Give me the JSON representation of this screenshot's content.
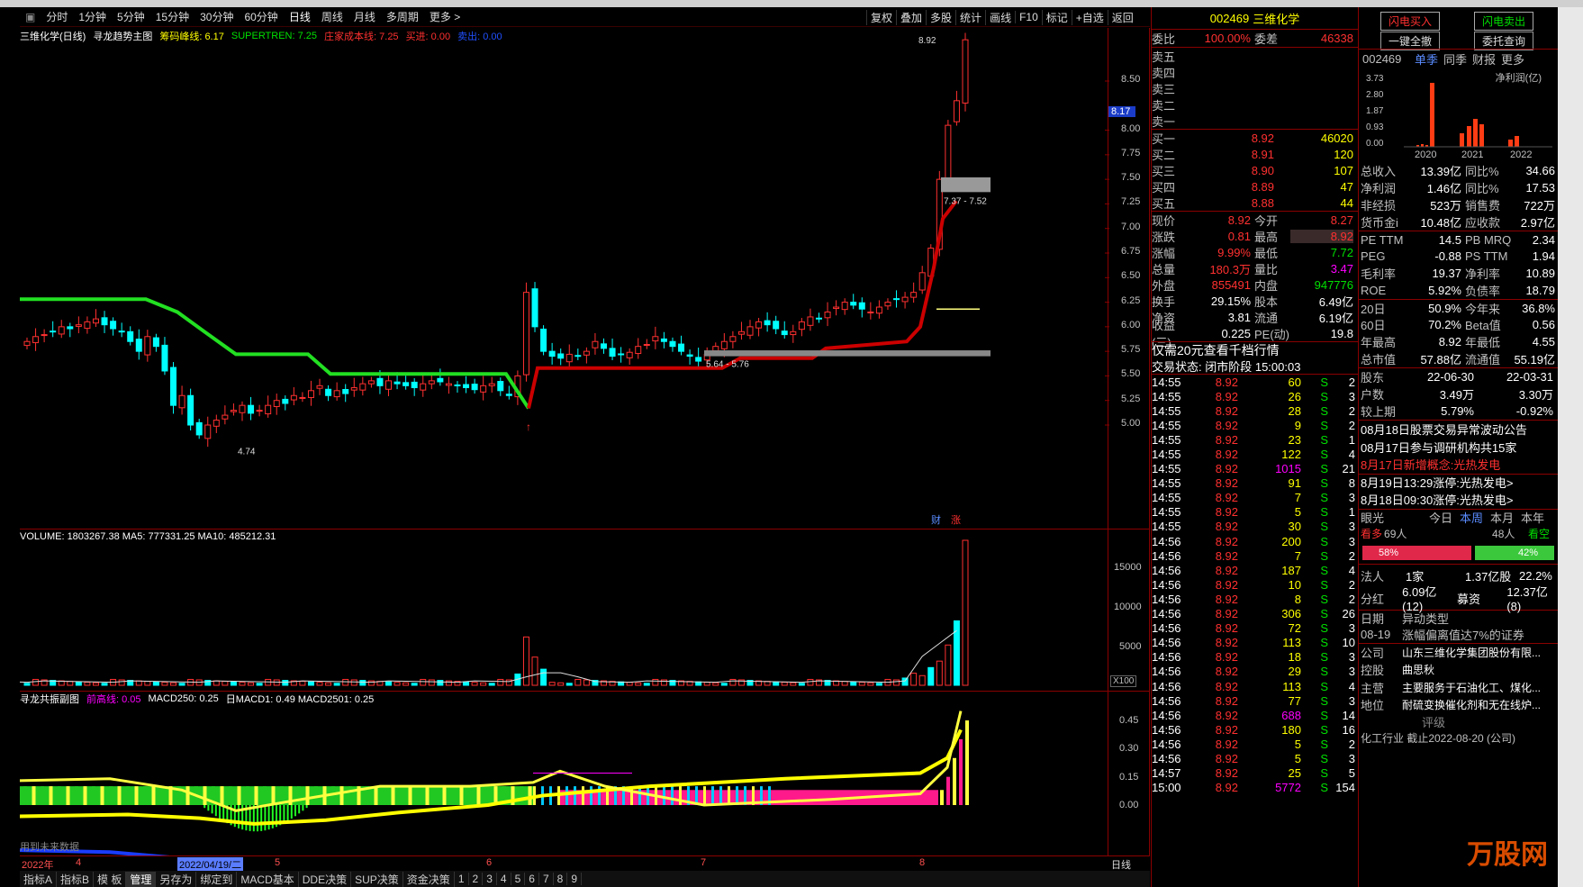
{
  "toolbar": {
    "items": [
      "分时",
      "1分钟",
      "5分钟",
      "15分钟",
      "30分钟",
      "60分钟",
      "日线",
      "周线",
      "月线",
      "多周期",
      "更多 >"
    ],
    "right": [
      "复权",
      "叠加",
      "多股",
      "统计",
      "画线",
      "F10",
      "标记",
      "+自选",
      "返回"
    ]
  },
  "main": {
    "legend": {
      "title": "三维化学(日线)",
      "indicator": "寻龙趋势主图",
      "chip": "筹码峰线: 6.17",
      "supertrend": "SUPERTREN: 7.25",
      "cost": "庄家成本线: 7.25",
      "buy": "买进: 0.00",
      "sell": "卖出: 0.00"
    },
    "y_labels": [
      "8.50",
      "8.00",
      "7.75",
      "7.50",
      "7.25",
      "7.00",
      "6.75",
      "6.50",
      "6.25",
      "6.00",
      "5.75",
      "5.50",
      "5.25",
      "5.00"
    ],
    "price_tag": "8.17",
    "high_label": "8.92",
    "low_label": "4.74",
    "box_label_high": "7.37 - 7.52",
    "box_label_low": "5.64 - 5.76",
    "cai": "财",
    "zhang": "涨"
  },
  "volume": {
    "legend": "VOLUME: 1803267.38  MA5: 777331.25  MA10: 485212.31",
    "y_labels": [
      "15000",
      "10000",
      "5000"
    ],
    "unit": "X100"
  },
  "macd": {
    "legend_a": "寻龙共振副图",
    "legend_b": "前高线: 0.05",
    "legend_c": "MACD250: 0.25",
    "legend_d": "日MACD1: 0.49  MACD2501: 0.25",
    "y_labels": [
      "0.45",
      "0.30",
      "0.15",
      "0.00"
    ],
    "note": "用到未来数据"
  },
  "timeaxis": {
    "year": "2022年",
    "m4": "4",
    "date": "2022/04/19/二",
    "m5": "5",
    "m6": "6",
    "m7": "7",
    "m8": "8",
    "period": "日线"
  },
  "tabs": [
    "指标A",
    "指标B",
    "模 板",
    "管理",
    "另存为",
    "绑定到",
    "MACD基本",
    "DDE决策",
    "SUP决策",
    "资金决策",
    "1",
    "2",
    "3",
    "4",
    "5",
    "6",
    "7",
    "8",
    "9"
  ],
  "quote": {
    "code": "002469",
    "name": "三维化学",
    "weibi_label": "委比",
    "weibi": "100.00%",
    "weicha_label": "委差",
    "weicha": "46338",
    "sells": [
      "卖五",
      "卖四",
      "卖三",
      "卖二",
      "卖一"
    ],
    "buys": [
      {
        "l": "买一",
        "p": "8.92",
        "v": "46020"
      },
      {
        "l": "买二",
        "p": "8.91",
        "v": "120"
      },
      {
        "l": "买三",
        "p": "8.90",
        "v": "107"
      },
      {
        "l": "买四",
        "p": "8.89",
        "v": "47"
      },
      {
        "l": "买五",
        "p": "8.88",
        "v": "44"
      }
    ],
    "stats": [
      [
        "现价",
        "8.92",
        "今开",
        "8.27"
      ],
      [
        "涨跌",
        "0.81",
        "最高",
        "8.92"
      ],
      [
        "涨幅",
        "9.99%",
        "最低",
        "7.72"
      ],
      [
        "总量",
        "180.3万",
        "量比",
        "3.47"
      ],
      [
        "外盘",
        "855491",
        "内盘",
        "947776"
      ],
      [
        "换手",
        "29.15%",
        "股本",
        "6.49亿"
      ],
      [
        "净资",
        "3.81",
        "流通",
        "6.19亿"
      ],
      [
        "收益(三)",
        "0.225",
        "PE(动)",
        "19.8"
      ]
    ],
    "promo": "仅需20元查看千档行情",
    "state": "交易状态: 闭市阶段 15:00:03",
    "ticks": [
      [
        "14:55",
        "8.92",
        "60",
        "S",
        "2"
      ],
      [
        "14:55",
        "8.92",
        "26",
        "S",
        "3"
      ],
      [
        "14:55",
        "8.92",
        "28",
        "S",
        "2"
      ],
      [
        "14:55",
        "8.92",
        "9",
        "S",
        "2"
      ],
      [
        "14:55",
        "8.92",
        "23",
        "S",
        "1"
      ],
      [
        "14:55",
        "8.92",
        "122",
        "S",
        "4"
      ],
      [
        "14:55",
        "8.92",
        "1015",
        "S",
        "21"
      ],
      [
        "14:55",
        "8.92",
        "91",
        "S",
        "8"
      ],
      [
        "14:55",
        "8.92",
        "7",
        "S",
        "3"
      ],
      [
        "14:55",
        "8.92",
        "5",
        "S",
        "1"
      ],
      [
        "14:55",
        "8.92",
        "30",
        "S",
        "3"
      ],
      [
        "14:56",
        "8.92",
        "200",
        "S",
        "3"
      ],
      [
        "14:56",
        "8.92",
        "7",
        "S",
        "2"
      ],
      [
        "14:56",
        "8.92",
        "187",
        "S",
        "4"
      ],
      [
        "14:56",
        "8.92",
        "10",
        "S",
        "2"
      ],
      [
        "14:56",
        "8.92",
        "8",
        "S",
        "2"
      ],
      [
        "14:56",
        "8.92",
        "306",
        "S",
        "26"
      ],
      [
        "14:56",
        "8.92",
        "72",
        "S",
        "3"
      ],
      [
        "14:56",
        "8.92",
        "113",
        "S",
        "10"
      ],
      [
        "14:56",
        "8.92",
        "18",
        "S",
        "3"
      ],
      [
        "14:56",
        "8.92",
        "29",
        "S",
        "3"
      ],
      [
        "14:56",
        "8.92",
        "113",
        "S",
        "4"
      ],
      [
        "14:56",
        "8.92",
        "77",
        "S",
        "3"
      ],
      [
        "14:56",
        "8.92",
        "688",
        "S",
        "14"
      ],
      [
        "14:56",
        "8.92",
        "180",
        "S",
        "16"
      ],
      [
        "14:56",
        "8.92",
        "5",
        "S",
        "2"
      ],
      [
        "14:56",
        "8.92",
        "5",
        "S",
        "3"
      ],
      [
        "14:57",
        "8.92",
        "25",
        "S",
        "5"
      ],
      [
        "15:00",
        "8.92",
        "5772",
        "S",
        "154"
      ]
    ]
  },
  "f10": {
    "btn1": "闪电买入",
    "btn2": "闪电卖出",
    "btn3": "一键全撤",
    "btn4": "委托查询",
    "code": "002469",
    "tabs": [
      "单季",
      "同季",
      "财报",
      "更多"
    ],
    "chart_title": "净利润(亿)",
    "chart_y": [
      "3.73",
      "2.80",
      "1.87",
      "0.93",
      "0.00"
    ],
    "chart_x": [
      "2020",
      "2021",
      "2022"
    ],
    "rows": [
      [
        "总收入",
        "13.39亿",
        "同比%",
        "34.66"
      ],
      [
        "净利润",
        "1.46亿",
        "同比%",
        "17.53"
      ],
      [
        "非经损",
        "523万",
        "销售费",
        "722万"
      ],
      [
        "货币金i",
        "10.48亿",
        "应收款",
        "2.97亿"
      ],
      [
        "PE TTM",
        "14.5",
        "PB MRQ",
        "2.34"
      ],
      [
        "PEG",
        "-0.88",
        "PS TTM",
        "1.94"
      ],
      [
        "毛利率",
        "19.37",
        "净利率",
        "10.89"
      ],
      [
        "ROE",
        "5.92%",
        "负债率",
        "18.79"
      ],
      [
        "20日",
        "50.9%",
        "今年来",
        "36.8%"
      ],
      [
        "60日",
        "70.2%",
        "Beta值",
        "0.56"
      ],
      [
        "年最高",
        "8.92",
        "年最低",
        "4.55"
      ],
      [
        "总市值",
        "57.88亿",
        "流通值",
        "55.19亿"
      ]
    ],
    "holder": [
      [
        "股东",
        "22-06-30",
        "22-03-31"
      ],
      [
        "户数",
        "3.49万",
        "3.30万"
      ],
      [
        "较上期",
        "5.79%",
        "-0.92%"
      ]
    ],
    "news": [
      "08月18日股票交易异常波动公告",
      "08月17日参与调研机构共15家",
      "8月17日新增概念:光热发电",
      "8月19日13:29涨停:光热发电>",
      "8月18日09:30涨停:光热发电>"
    ],
    "yanguang": {
      "label": "眼光",
      "t1": "今日",
      "t2": "本周",
      "t3": "本月",
      "t4": "本年",
      "kan_duo": "看多",
      "duo_n": "69人",
      "kong_n": "48人",
      "kan_kong": "看空",
      "p1": "58%",
      "p2": "42%",
      "p1_val": 58
    },
    "misc": [
      [
        "法人",
        "1家",
        "1.37亿股",
        "22.2%"
      ],
      [
        "分红",
        "6.09亿(12)",
        "募资",
        "12.37亿(8)"
      ]
    ],
    "event": {
      "h1": "日期",
      "h2": "异动类型",
      "date": "08-19",
      "desc": "涨幅偏离值达7%的证券"
    },
    "company": [
      [
        "公司",
        "山东三维化学集团股份有限..."
      ],
      [
        "控股",
        "曲思秋"
      ],
      [
        "主营",
        "主要服务于石油化工、煤化..."
      ],
      [
        "地位",
        "耐硫变换催化剂和无在线炉..."
      ]
    ],
    "rating": "评级",
    "bottom": "化工行业 截止2022-08-20 (公司)",
    "watermark": "万股网"
  },
  "chart_data": {
    "type": "candlestick",
    "note_colors": {
      "up": "#ff3030",
      "down": "#00ffff",
      "st_up": "#cc0000",
      "st_down": "#22e022"
    }
  }
}
